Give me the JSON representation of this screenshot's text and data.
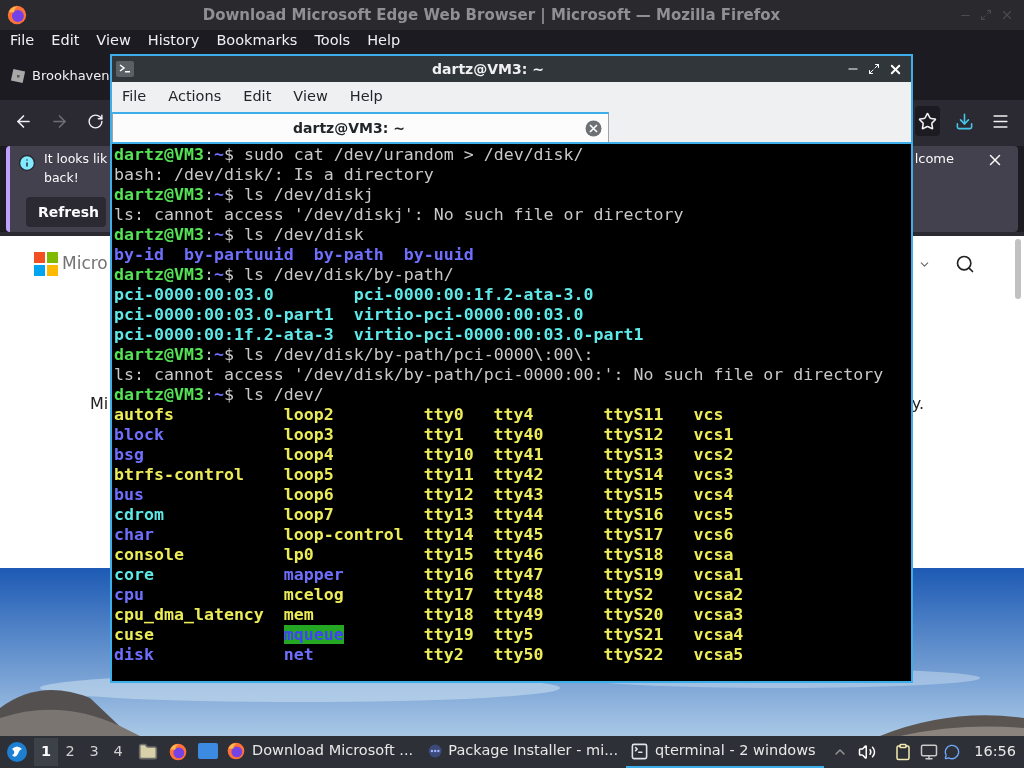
{
  "firefox": {
    "title": "Download Microsoft Edge Web Browser | Microsoft — Mozilla Firefox",
    "menu": [
      {
        "label": "File"
      },
      {
        "label": "Edit"
      },
      {
        "label": "View"
      },
      {
        "label": "History"
      },
      {
        "label": "Bookmarks"
      },
      {
        "label": "Tools"
      },
      {
        "label": "Help"
      }
    ],
    "tab": {
      "title": "Brookhaven"
    },
    "notification": {
      "message_start": "It looks lik",
      "message_end": "back!",
      "message_right": "lcome",
      "button": "Refresh"
    },
    "page": {
      "logo_text": "Micro",
      "text_left": "Mi",
      "text_right": "y."
    }
  },
  "terminal": {
    "title": "dartz@VM3: ~",
    "menu": [
      "File",
      "Actions",
      "Edit",
      "View",
      "Help"
    ],
    "tabs": [
      {
        "label": "dartz@VM3: ~",
        "selected": true
      }
    ],
    "lines": [
      {
        "kind": "prompt",
        "user": "dartz@VM3",
        "sep": ":",
        "path": "~",
        "symbol": "$",
        "command": "sudo cat /dev/urandom > /dev/disk/"
      },
      {
        "kind": "output",
        "text": "bash: /dev/disk/: Is a directory"
      },
      {
        "kind": "prompt",
        "user": "dartz@VM3",
        "sep": ":",
        "path": "~",
        "symbol": "$",
        "command": "ls /dev/diskj"
      },
      {
        "kind": "output",
        "text": "ls: cannot access '/dev/diskj': No such file or directory"
      },
      {
        "kind": "prompt",
        "user": "dartz@VM3",
        "sep": ":",
        "path": "~",
        "symbol": "$",
        "command": "ls /dev/disk"
      },
      {
        "kind": "listing",
        "rows": [
          [
            {
              "text": "by-id",
              "kind": "dir"
            },
            {
              "text": "by-partuuid",
              "kind": "dir"
            },
            {
              "text": "by-path",
              "kind": "dir"
            },
            {
              "text": "by-uuid",
              "kind": "dir"
            }
          ]
        ]
      },
      {
        "kind": "prompt",
        "user": "dartz@VM3",
        "sep": ":",
        "path": "~",
        "symbol": "$",
        "command": "ls /dev/disk/by-path/"
      },
      {
        "kind": "listing",
        "rows": [
          [
            {
              "text": "pci-0000:00:03.0",
              "kind": "link"
            },
            {
              "text": "pci-0000:00:1f.2-ata-3.0",
              "kind": "link"
            }
          ],
          [
            {
              "text": "pci-0000:00:03.0-part1",
              "kind": "link"
            },
            {
              "text": "virtio-pci-0000:00:03.0",
              "kind": "link"
            }
          ],
          [
            {
              "text": "pci-0000:00:1f.2-ata-3",
              "kind": "link"
            },
            {
              "text": "virtio-pci-0000:00:03.0-part1",
              "kind": "link"
            }
          ]
        ]
      },
      {
        "kind": "prompt",
        "user": "dartz@VM3",
        "sep": ":",
        "path": "~",
        "symbol": "$",
        "command": "ls /dev/disk/by-path/pci-0000\\:00\\:"
      },
      {
        "kind": "output",
        "text": "ls: cannot access '/dev/disk/by-path/pci-0000:00:': No such file or directory"
      },
      {
        "kind": "prompt",
        "user": "dartz@VM3",
        "sep": ":",
        "path": "~",
        "symbol": "$",
        "command": "ls /dev/"
      },
      {
        "kind": "listing",
        "rows": [
          [
            {
              "text": "autofs",
              "kind": "device"
            },
            {
              "text": "loop2",
              "kind": "device"
            },
            {
              "text": "tty0",
              "kind": "device"
            },
            {
              "text": "tty4",
              "kind": "device"
            },
            {
              "text": "ttyS11",
              "kind": "device"
            },
            {
              "text": "vcs",
              "kind": "device"
            }
          ],
          [
            {
              "text": "block",
              "kind": "dir"
            },
            {
              "text": "loop3",
              "kind": "device"
            },
            {
              "text": "tty1",
              "kind": "device"
            },
            {
              "text": "tty40",
              "kind": "device"
            },
            {
              "text": "ttyS12",
              "kind": "device"
            },
            {
              "text": "vcs1",
              "kind": "device"
            }
          ],
          [
            {
              "text": "bsg",
              "kind": "dir"
            },
            {
              "text": "loop4",
              "kind": "device"
            },
            {
              "text": "tty10",
              "kind": "device"
            },
            {
              "text": "tty41",
              "kind": "device"
            },
            {
              "text": "ttyS13",
              "kind": "device"
            },
            {
              "text": "vcs2",
              "kind": "device"
            }
          ],
          [
            {
              "text": "btrfs-control",
              "kind": "device"
            },
            {
              "text": "loop5",
              "kind": "device"
            },
            {
              "text": "tty11",
              "kind": "device"
            },
            {
              "text": "tty42",
              "kind": "device"
            },
            {
              "text": "ttyS14",
              "kind": "device"
            },
            {
              "text": "vcs3",
              "kind": "device"
            }
          ],
          [
            {
              "text": "bus",
              "kind": "dir"
            },
            {
              "text": "loop6",
              "kind": "device"
            },
            {
              "text": "tty12",
              "kind": "device"
            },
            {
              "text": "tty43",
              "kind": "device"
            },
            {
              "text": "ttyS15",
              "kind": "device"
            },
            {
              "text": "vcs4",
              "kind": "device"
            }
          ],
          [
            {
              "text": "cdrom",
              "kind": "link"
            },
            {
              "text": "loop7",
              "kind": "device"
            },
            {
              "text": "tty13",
              "kind": "device"
            },
            {
              "text": "tty44",
              "kind": "device"
            },
            {
              "text": "ttyS16",
              "kind": "device"
            },
            {
              "text": "vcs5",
              "kind": "device"
            }
          ],
          [
            {
              "text": "char",
              "kind": "dir"
            },
            {
              "text": "loop-control",
              "kind": "device"
            },
            {
              "text": "tty14",
              "kind": "device"
            },
            {
              "text": "tty45",
              "kind": "device"
            },
            {
              "text": "ttyS17",
              "kind": "device"
            },
            {
              "text": "vcs6",
              "kind": "device"
            }
          ],
          [
            {
              "text": "console",
              "kind": "device"
            },
            {
              "text": "lp0",
              "kind": "device"
            },
            {
              "text": "tty15",
              "kind": "device"
            },
            {
              "text": "tty46",
              "kind": "device"
            },
            {
              "text": "ttyS18",
              "kind": "device"
            },
            {
              "text": "vcsa",
              "kind": "device"
            }
          ],
          [
            {
              "text": "core",
              "kind": "link"
            },
            {
              "text": "mapper",
              "kind": "dir"
            },
            {
              "text": "tty16",
              "kind": "device"
            },
            {
              "text": "tty47",
              "kind": "device"
            },
            {
              "text": "ttyS19",
              "kind": "device"
            },
            {
              "text": "vcsa1",
              "kind": "device"
            }
          ],
          [
            {
              "text": "cpu",
              "kind": "dir"
            },
            {
              "text": "mcelog",
              "kind": "device"
            },
            {
              "text": "tty17",
              "kind": "device"
            },
            {
              "text": "tty48",
              "kind": "device"
            },
            {
              "text": "ttyS2",
              "kind": "device"
            },
            {
              "text": "vcsa2",
              "kind": "device"
            }
          ],
          [
            {
              "text": "cpu_dma_latency",
              "kind": "device"
            },
            {
              "text": "mem",
              "kind": "device"
            },
            {
              "text": "tty18",
              "kind": "device"
            },
            {
              "text": "tty49",
              "kind": "device"
            },
            {
              "text": "ttyS20",
              "kind": "device"
            },
            {
              "text": "vcsa3",
              "kind": "device"
            }
          ],
          [
            {
              "text": "cuse",
              "kind": "device"
            },
            {
              "text": "mqueue",
              "kind": "sticky"
            },
            {
              "text": "tty19",
              "kind": "device"
            },
            {
              "text": "tty5",
              "kind": "device"
            },
            {
              "text": "ttyS21",
              "kind": "device"
            },
            {
              "text": "vcsa4",
              "kind": "device"
            }
          ],
          [
            {
              "text": "disk",
              "kind": "dir"
            },
            {
              "text": "net",
              "kind": "dir"
            },
            {
              "text": "tty2",
              "kind": "device"
            },
            {
              "text": "tty50",
              "kind": "device"
            },
            {
              "text": "ttyS22",
              "kind": "device"
            },
            {
              "text": "vcsa5",
              "kind": "device"
            }
          ]
        ]
      }
    ]
  },
  "taskbar": {
    "workspaces": [
      {
        "label": "1",
        "selected": true
      },
      {
        "label": "2",
        "selected": false
      },
      {
        "label": "3",
        "selected": false
      },
      {
        "label": "4",
        "selected": false
      }
    ],
    "tasks": [
      {
        "label": "Download Microsoft ...",
        "kind": "browser",
        "selected": false
      },
      {
        "label": "Package Installer - mi...",
        "kind": "installer",
        "selected": false
      },
      {
        "label": "qterminal - 2 windows",
        "kind": "terminal",
        "selected": true
      }
    ],
    "clock": "16:56"
  }
}
